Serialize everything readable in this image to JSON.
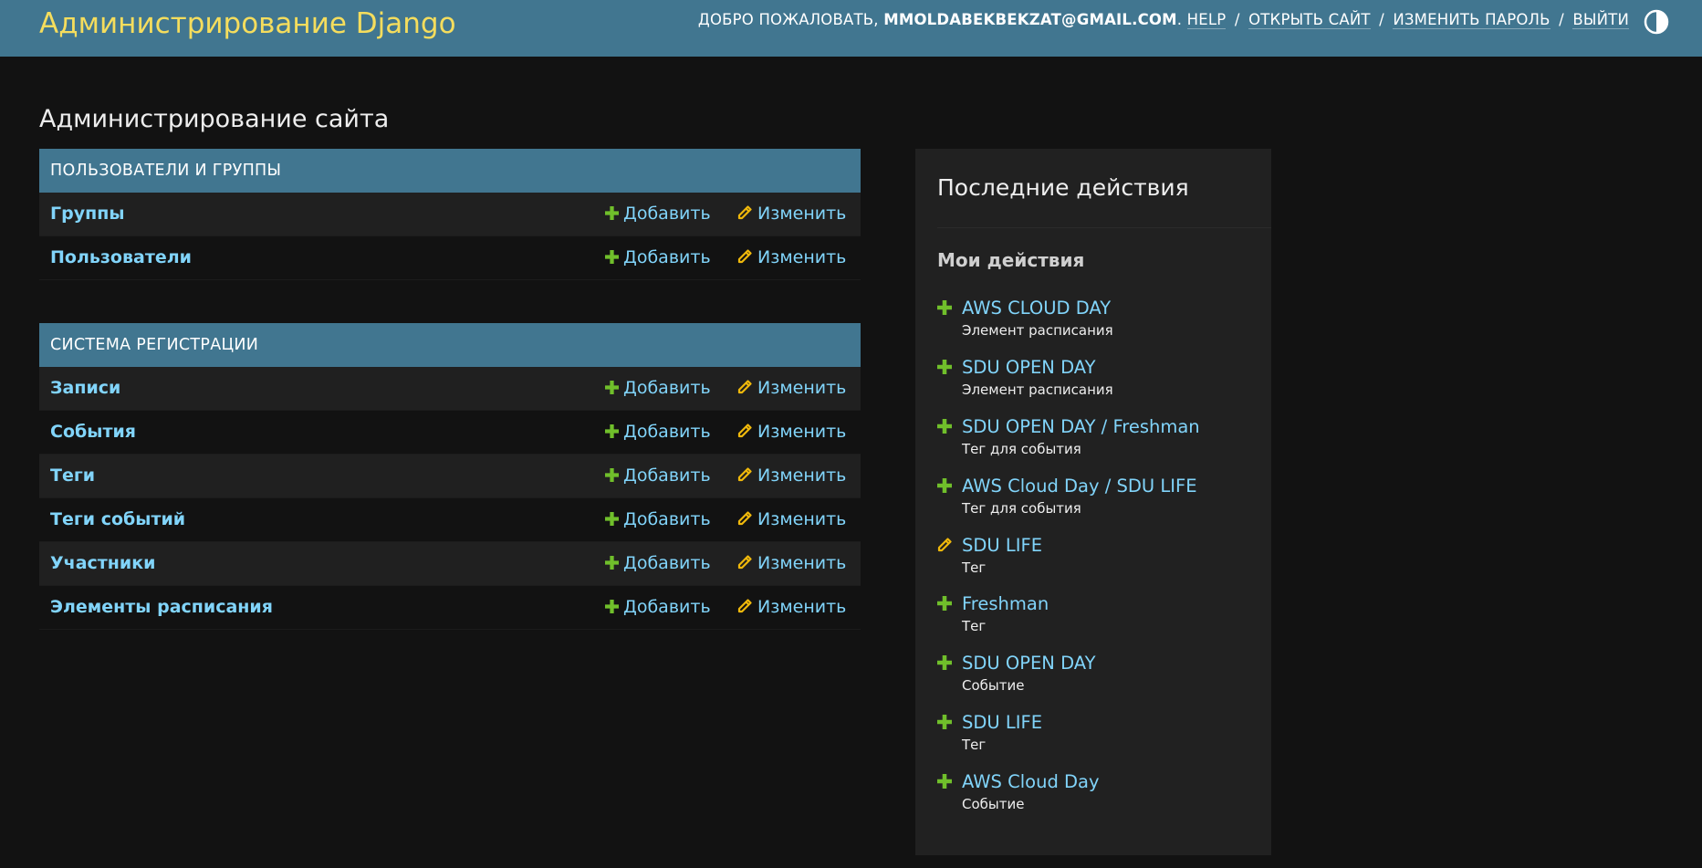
{
  "header": {
    "site_name": "Администрирование Django",
    "welcome": "ДОБРО ПОЖАЛОВАТЬ,",
    "username": "MMOLDABEKBEKZAT@GMAIL.COM",
    "welcome_end": ".",
    "links": {
      "help": "HELP",
      "view_site": "ОТКРЫТЬ САЙТ",
      "change_password": "ИЗМЕНИТЬ ПАРОЛЬ",
      "logout": "ВЫЙТИ"
    },
    "separator": "/",
    "theme_toggle_icon": "half-circle-icon"
  },
  "page_title": "Администрирование сайта",
  "apps": [
    {
      "caption": "Пользователи и группы",
      "models": [
        {
          "name": "Группы",
          "add": "Добавить",
          "change": "Изменить"
        },
        {
          "name": "Пользователи",
          "add": "Добавить",
          "change": "Изменить"
        }
      ]
    },
    {
      "caption": "Система регистрации",
      "models": [
        {
          "name": "Записи",
          "add": "Добавить",
          "change": "Изменить"
        },
        {
          "name": "События",
          "add": "Добавить",
          "change": "Изменить"
        },
        {
          "name": "Теги",
          "add": "Добавить",
          "change": "Изменить"
        },
        {
          "name": "Теги событий",
          "add": "Добавить",
          "change": "Изменить"
        },
        {
          "name": "Участники",
          "add": "Добавить",
          "change": "Изменить"
        },
        {
          "name": "Элементы расписания",
          "add": "Добавить",
          "change": "Изменить"
        }
      ]
    }
  ],
  "recent_actions": {
    "title": "Последние действия",
    "subtitle": "Мои действия",
    "items": [
      {
        "action": "add",
        "icon": "plus-icon",
        "label": "AWS CLOUD DAY",
        "type": "Элемент расписания"
      },
      {
        "action": "add",
        "icon": "plus-icon",
        "label": "SDU OPEN DAY",
        "type": "Элемент расписания"
      },
      {
        "action": "add",
        "icon": "plus-icon",
        "label": "SDU OPEN DAY / Freshman",
        "type": "Тег для события"
      },
      {
        "action": "add",
        "icon": "plus-icon",
        "label": "AWS Cloud Day / SDU LIFE",
        "type": "Тег для события"
      },
      {
        "action": "change",
        "icon": "pencil-icon",
        "label": "SDU LIFE",
        "type": "Тег"
      },
      {
        "action": "add",
        "icon": "plus-icon",
        "label": "Freshman",
        "type": "Тег"
      },
      {
        "action": "add",
        "icon": "plus-icon",
        "label": "SDU OPEN DAY",
        "type": "Событие"
      },
      {
        "action": "add",
        "icon": "plus-icon",
        "label": "SDU LIFE",
        "type": "Тег"
      },
      {
        "action": "add",
        "icon": "plus-icon",
        "label": "AWS Cloud Day",
        "type": "Событие"
      }
    ]
  },
  "colors": {
    "header_bg": "#417690",
    "site_name": "#f5dd5d",
    "link": "#81d4fa",
    "add_icon": "#70bf2b",
    "change_icon": "#efb80b",
    "page_bg": "#121212"
  }
}
